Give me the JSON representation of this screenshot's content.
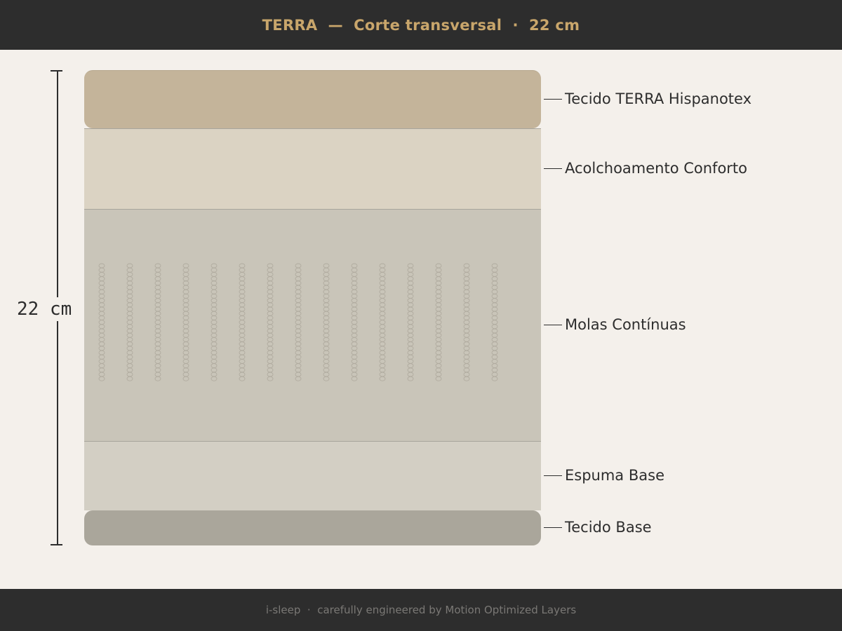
{
  "header": {
    "title": "TERRA  —  Corte transversal  ·  22 cm"
  },
  "dimension": {
    "label": "22 cm"
  },
  "layers": [
    {
      "label": "Tecido TERRA Hispanotex",
      "color": "#c4b49a"
    },
    {
      "label": "Acolchoamento Conforto",
      "color": "#dbd3c3"
    },
    {
      "label": "Molas Contínuas",
      "color": "#c9c5b9"
    },
    {
      "label": "Espuma Base",
      "color": "#d3cfc4"
    },
    {
      "label": "Tecido Base",
      "color": "#aaa69b"
    }
  ],
  "springs": {
    "columns": 15,
    "coils_per_column": 27,
    "color": "#b0ab9f"
  },
  "footer": {
    "text": "i-sleep  ·  carefully engineered by Motion Optimized Layers"
  }
}
